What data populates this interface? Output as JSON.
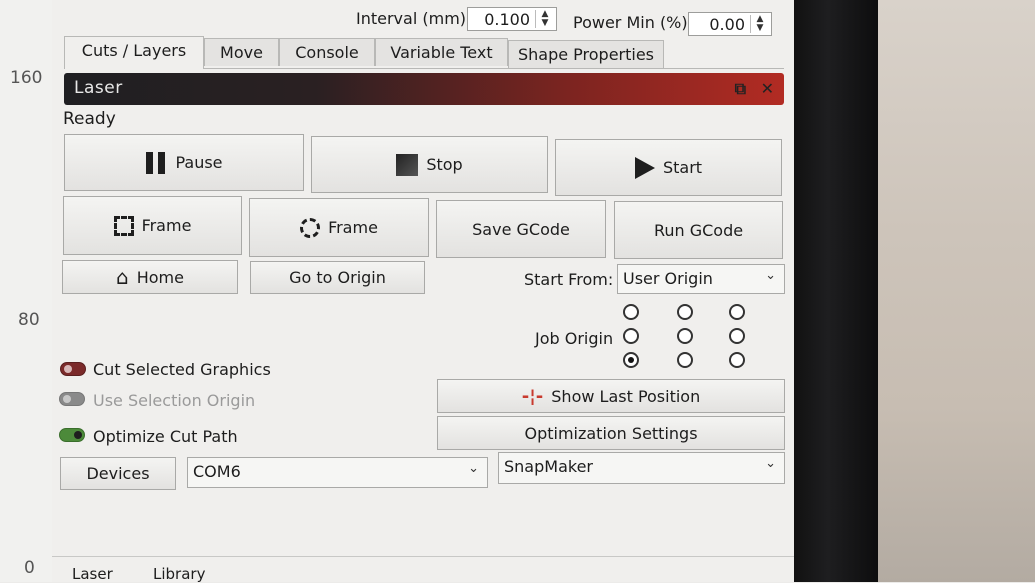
{
  "ruler": {
    "marks": [
      "160",
      "80",
      "0"
    ]
  },
  "top_row": {
    "interval_label": "Interval (mm)",
    "interval_value": "0.100",
    "power_min_label": "Power Min (%)",
    "power_min_value": "0.00"
  },
  "tabs": [
    {
      "label": "Cuts / Layers",
      "active": true
    },
    {
      "label": "Move"
    },
    {
      "label": "Console"
    },
    {
      "label": "Variable Text"
    },
    {
      "label": "Shape Properties"
    }
  ],
  "laser_panel": {
    "title": "Laser",
    "status": "Ready",
    "buttons": {
      "pause": "Pause",
      "stop": "Stop",
      "start": "Start",
      "frame_rect": "Frame",
      "frame_circle": "Frame",
      "save_gcode": "Save GCode",
      "run_gcode": "Run GCode",
      "home": "Home",
      "go_to_origin": "Go to Origin",
      "show_last_position": "Show Last Position",
      "optimization_settings": "Optimization Settings",
      "devices": "Devices"
    },
    "start_from_label": "Start From:",
    "start_from_value": "User Origin",
    "job_origin_label": "Job Origin",
    "job_origin_selected": "bottom-left",
    "options": {
      "cut_selected_graphics": "Cut Selected Graphics",
      "use_selection_origin": "Use Selection Origin",
      "optimize_cut_path": "Optimize Cut Path"
    },
    "port_value": "COM6",
    "device_value": "SnapMaker"
  },
  "bottom_tabs": [
    "Laser",
    "Library"
  ],
  "colors": {
    "header_red": "#b22b23",
    "toggle_red": "#7b2a2a",
    "toggle_gray": "#8a8a8a",
    "toggle_green": "#4c8a3a"
  }
}
